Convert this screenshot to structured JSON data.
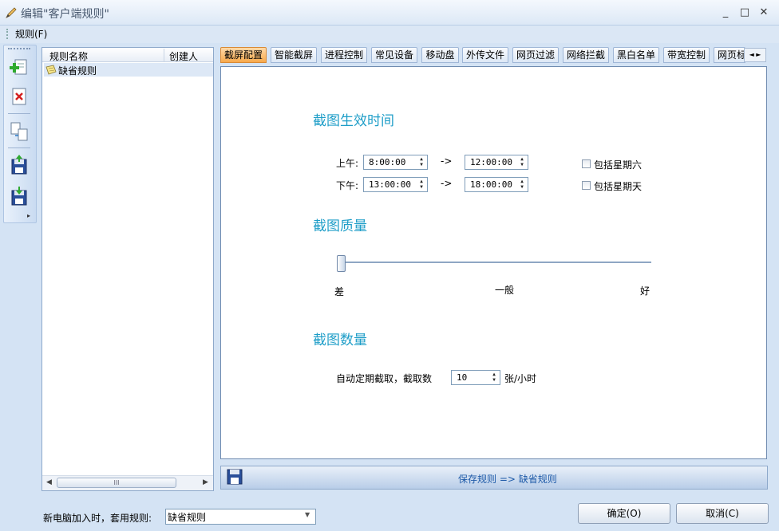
{
  "window": {
    "title": "编辑\"客户端规则\"",
    "min": "_",
    "max": "□",
    "close": "✕"
  },
  "menu": {
    "rule": "规则(F)"
  },
  "rule_list": {
    "col_name": "规则名称",
    "col_creator": "创建人",
    "rows": [
      {
        "name": "缺省规则"
      }
    ],
    "scroll_thumb": "III"
  },
  "tabs": [
    {
      "label": "截屏配置",
      "active": true
    },
    {
      "label": "智能截屏"
    },
    {
      "label": "进程控制"
    },
    {
      "label": "常见设备"
    },
    {
      "label": "移动盘"
    },
    {
      "label": "外传文件"
    },
    {
      "label": "网页过滤"
    },
    {
      "label": "网络拦截"
    },
    {
      "label": "黑白名单"
    },
    {
      "label": "带宽控制"
    },
    {
      "label": "网页标"
    }
  ],
  "tab_scroll": {
    "left": "◄",
    "right": "►"
  },
  "screenshot": {
    "time_heading": "截图生效时间",
    "am_label": "上午:",
    "am_start": "8:00:00",
    "am_end": "12:00:00",
    "pm_label": "下午:",
    "pm_start": "13:00:00",
    "pm_end": "18:00:00",
    "arrow": "->",
    "include_sat": "包括星期六",
    "include_sun": "包括星期天",
    "quality_heading": "截图质量",
    "quality_low": "差",
    "quality_mid": "一般",
    "quality_high": "好",
    "quality_value": 0,
    "count_heading": "截图数量",
    "count_label": "自动定期截取，截取数",
    "count_value": "10",
    "count_unit": "张/小时"
  },
  "savebar": {
    "text": "保存规则 => 缺省规则"
  },
  "footer": {
    "label": "新电脑加入时，套用规则:",
    "select_value": "缺省规则",
    "ok": "确定(O)",
    "cancel": "取消(C)"
  },
  "colors": {
    "accent": "#1f9ec8",
    "tab_active": "#f7a94c"
  }
}
